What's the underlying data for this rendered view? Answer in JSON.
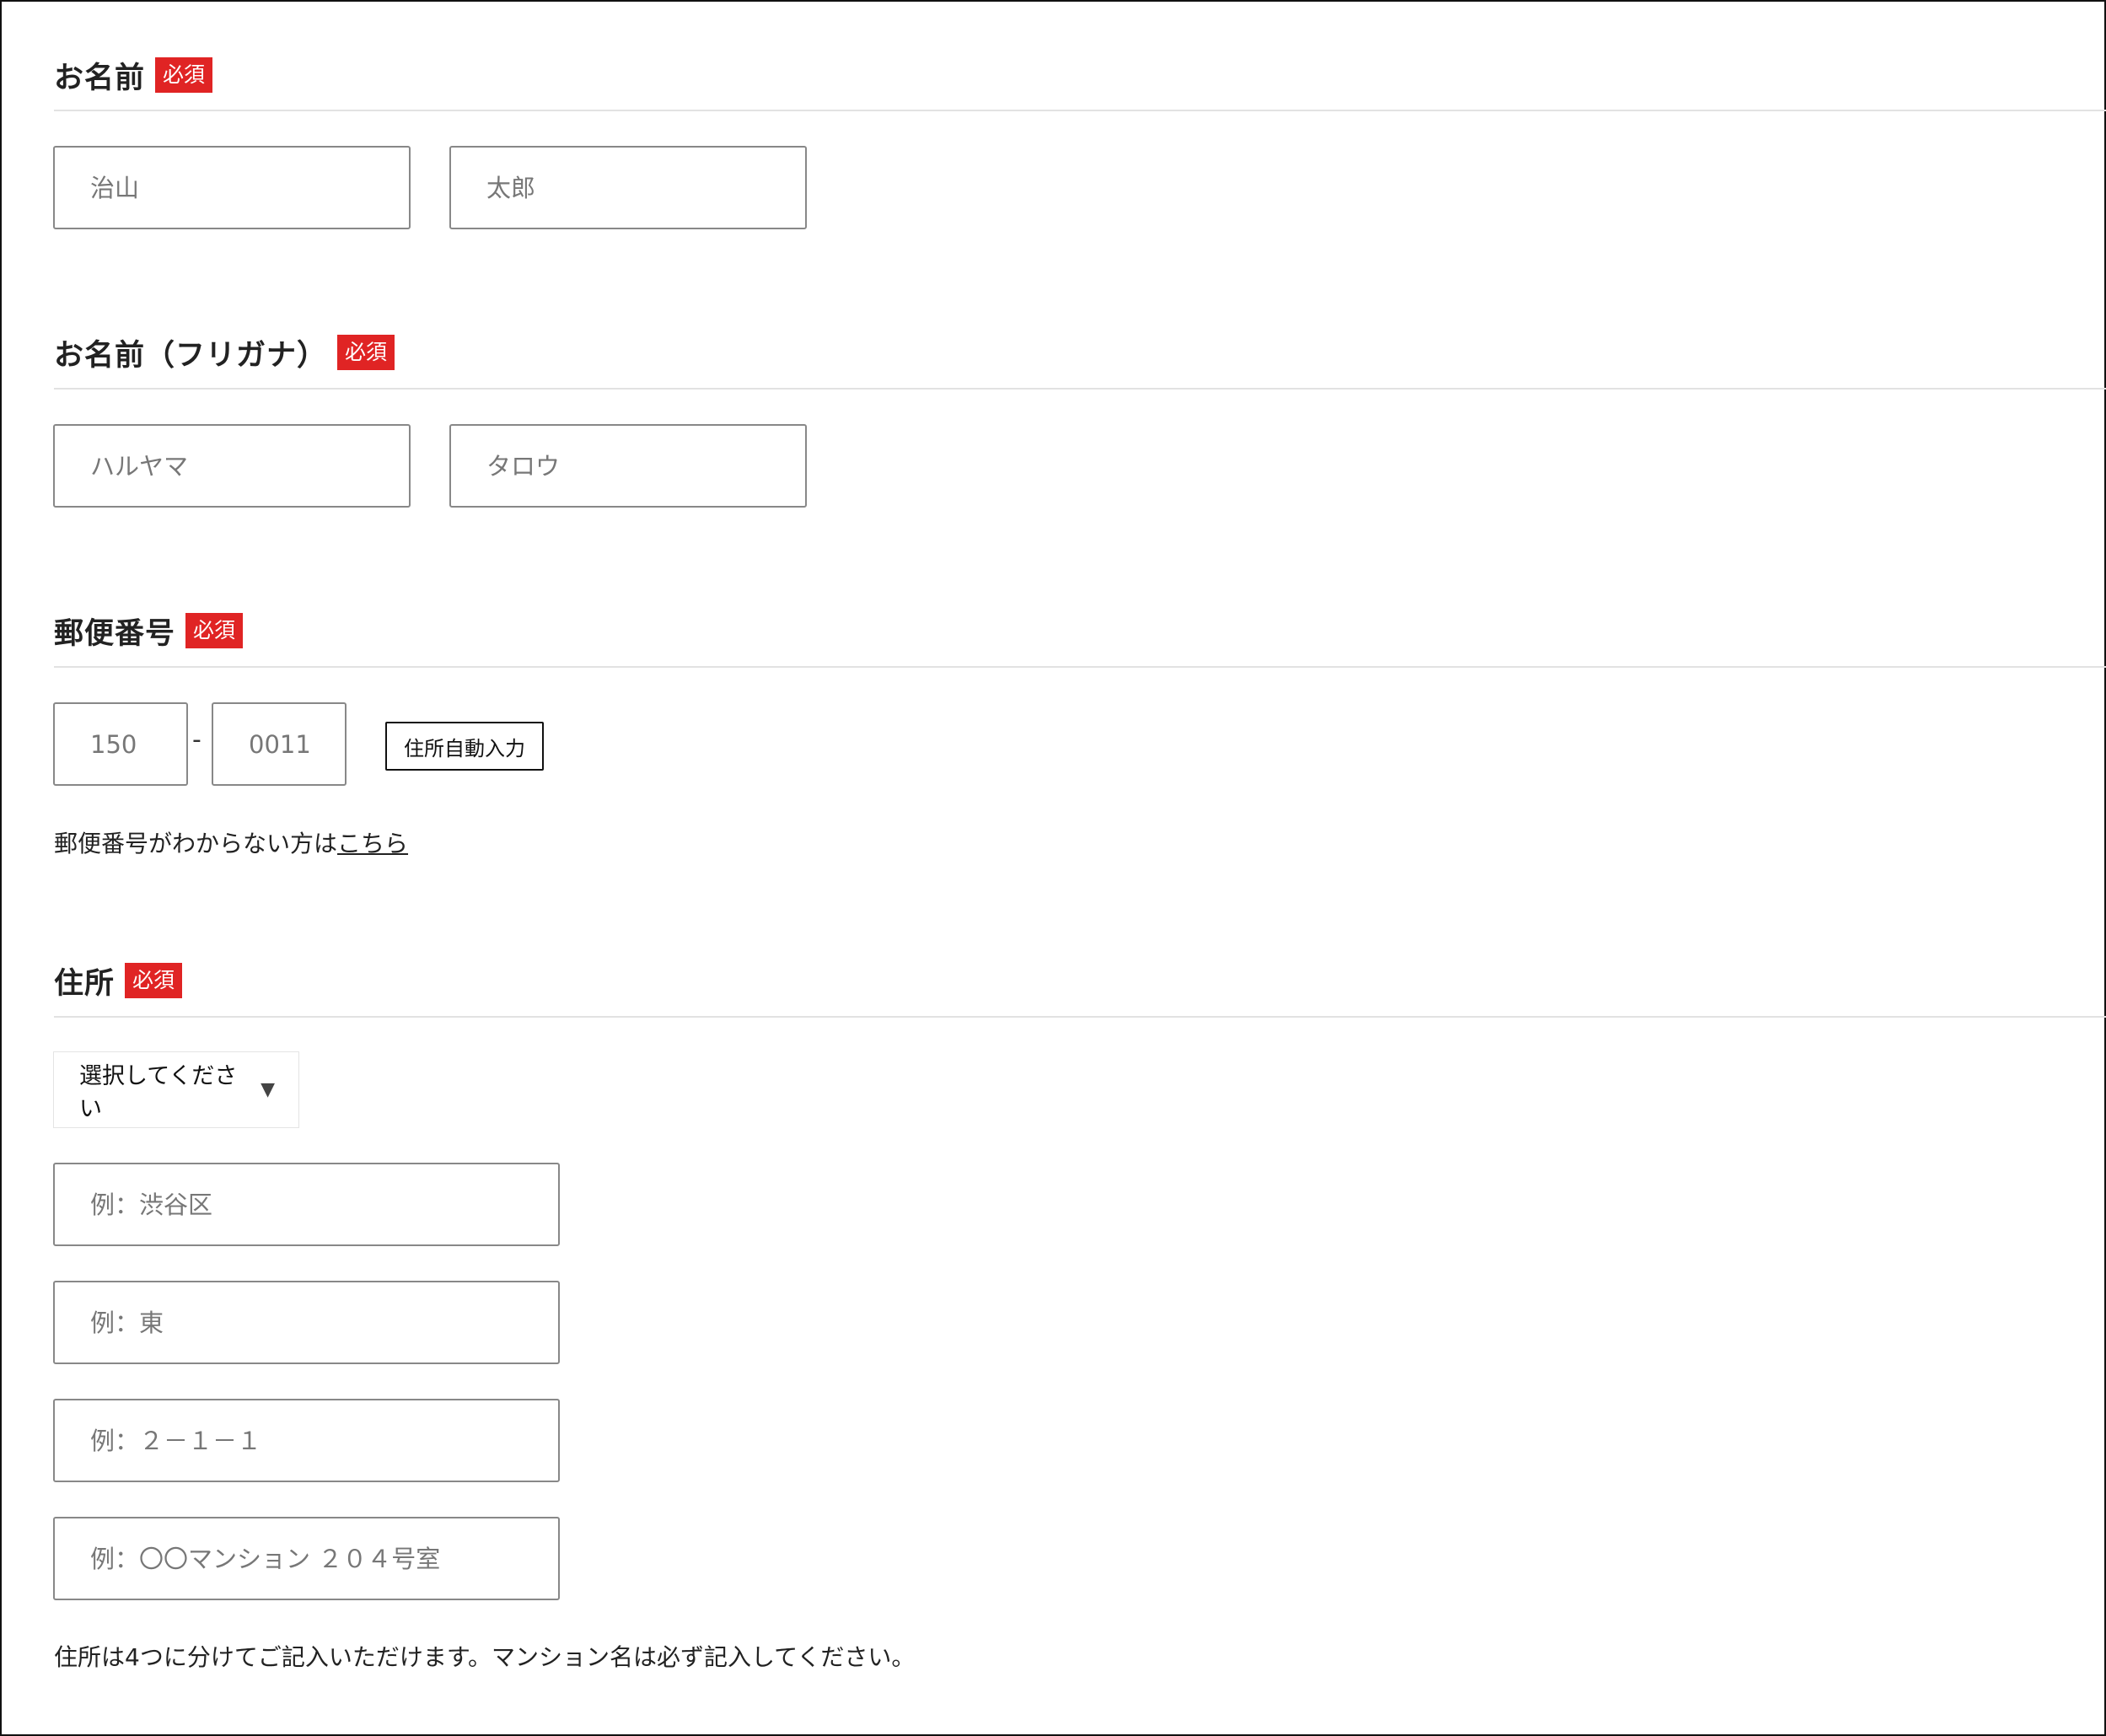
{
  "form": {
    "name": {
      "label": "お名前",
      "badge": "必須",
      "last_placeholder": "治山",
      "first_placeholder": "太郎"
    },
    "kana": {
      "label": "お名前（フリガナ）",
      "badge": "必須",
      "last_placeholder": "ハルヤマ",
      "first_placeholder": "タロウ"
    },
    "postal": {
      "label": "郵便番号",
      "badge": "必須",
      "zip1_placeholder": "150",
      "separator": "-",
      "zip2_placeholder": "0011",
      "autofill_button": "住所自動入力",
      "help_text": "郵便番号がわからない方は",
      "help_link": "こちら"
    },
    "address": {
      "label": "住所",
      "badge": "必須",
      "prefecture_select": "選択してください",
      "city_placeholder": "例：渋谷区",
      "town_placeholder": "例：東",
      "street_placeholder": "例：２－１－１",
      "building_placeholder": "例：〇〇マンション ２０４号室",
      "note": "住所は4つに分けてご記入いただけます。マンション名は必ず記入してください。"
    }
  },
  "colors": {
    "badge": "#e02424",
    "border": "#888888",
    "rule": "#e2e2e2"
  },
  "icons": {
    "select_arrow": "triangle-down-icon"
  }
}
